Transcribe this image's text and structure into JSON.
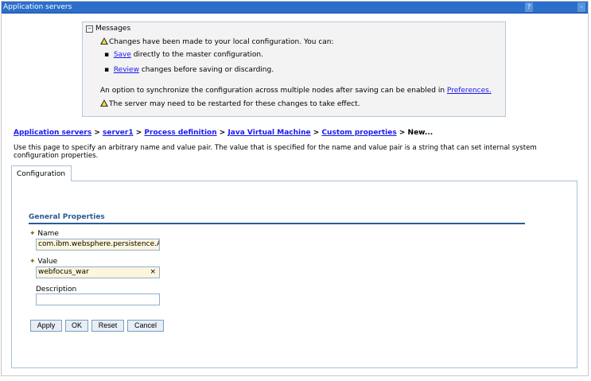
{
  "window": {
    "title": "Application servers",
    "help_icon": "?",
    "minimize_icon": "-"
  },
  "messages": {
    "title": "Messages",
    "line1": "Changes have been made to your local configuration. You can:",
    "save_link": "Save",
    "save_text": " directly to the master configuration.",
    "review_link": "Review",
    "review_text": " changes before saving or discarding.",
    "sync_text": "An option to synchronize the configuration across multiple nodes after saving can be enabled in ",
    "preferences_link": "Preferences.",
    "restart_text": "The server may need to be restarted for these changes to take effect."
  },
  "breadcrumb": {
    "items": [
      "Application servers",
      "server1",
      "Process definition",
      "Java Virtual Machine",
      "Custom properties"
    ],
    "separator": " > ",
    "current": "New..."
  },
  "description": [
    "Use this page to specify an arbitrary name and value pair. The value that is specified for the name and value pair is a string that can set internal system",
    "configuration properties."
  ],
  "tabs": [
    {
      "label": "Configuration",
      "active": true
    }
  ],
  "form": {
    "section": "General Properties",
    "name_label": "Name",
    "name_value": "com.ibm.websphere.persistence.A",
    "value_label": "Value",
    "value_value": "webfocus_war",
    "clear_icon": "×",
    "description_label": "Description",
    "description_value": "",
    "required_icon": "✦"
  },
  "buttons": {
    "apply": "Apply",
    "ok": "OK",
    "reset": "Reset",
    "cancel": "Cancel"
  },
  "colors": {
    "titlebar": "#2b6fcb",
    "link": "#1a1aee",
    "section": "#2a5a96",
    "input_bg": "#fdf5dc"
  }
}
